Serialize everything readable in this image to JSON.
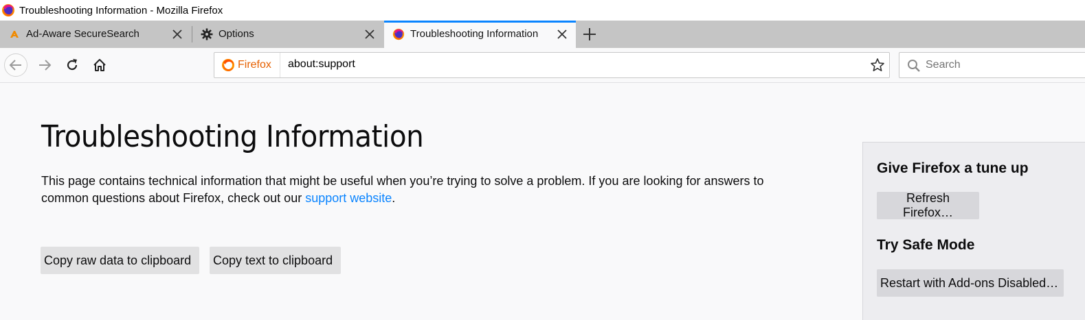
{
  "window": {
    "title": "Troubleshooting Information - Mozilla Firefox"
  },
  "tabs": [
    {
      "label": "Ad-Aware SecureSearch",
      "icon": "ad-aware-icon",
      "active": false
    },
    {
      "label": "Options",
      "icon": "gear-icon",
      "active": false
    },
    {
      "label": "Troubleshooting Information",
      "icon": "firefox-icon",
      "active": true
    }
  ],
  "navbar": {
    "identity_label": "Firefox",
    "url": "about:support",
    "search_placeholder": "Search"
  },
  "content": {
    "title": "Troubleshooting Information",
    "intro_text": "This page contains technical information that might be useful when you’re trying to solve a problem. If you are looking for answers to common questions about Firefox, check out our ",
    "intro_link": "support website",
    "intro_end": ".",
    "copy_raw_label": "Copy raw data to clipboard",
    "copy_text_label": "Copy text to clipboard"
  },
  "sidebox": {
    "tuneup_heading": "Give Firefox a tune up",
    "refresh_label": "Refresh Firefox…",
    "safemode_heading": "Try Safe Mode",
    "restart_label": "Restart with Add-ons Disabled…"
  },
  "colors": {
    "accent": "#0a84ff",
    "firefox_orange": "#e66000",
    "tabstrip": "#c5c5c5",
    "page_bg": "#f9f9fa"
  }
}
